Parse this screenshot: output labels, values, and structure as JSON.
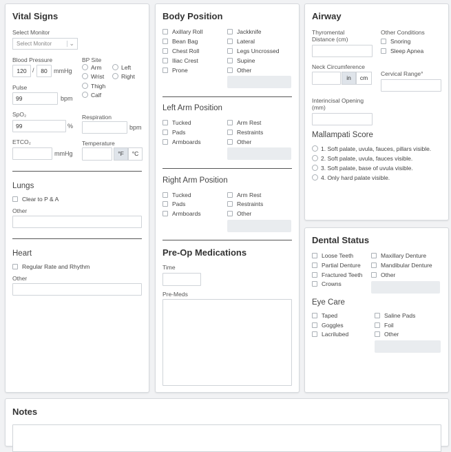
{
  "vital_signs": {
    "title": "Vital Signs",
    "select_monitor_label": "Select Monitor",
    "select_monitor_value": "Select Monitor",
    "bp_label": "Blood Pressure",
    "bp_systolic": "120",
    "bp_slash": "/",
    "bp_diastolic": "80",
    "bp_unit": "mmHg",
    "bp_site_label": "BP Site",
    "bp_sites": [
      "Arm",
      "Wrist",
      "Thigh",
      "Calf",
      "Left",
      "Right"
    ],
    "pulse_label": "Pulse",
    "pulse_value": "99",
    "pulse_unit": "bpm",
    "spo2_label": "SpO₂",
    "spo2_value": "99",
    "spo2_unit": "%",
    "resp_label": "Respiration",
    "resp_unit": "bpm",
    "etco2_label": "ETCO₂",
    "etco2_unit": "mmHg",
    "temp_label": "Temperature",
    "temp_f": "°F",
    "temp_c": "°C"
  },
  "lungs": {
    "title": "Lungs",
    "option": "Clear to P & A",
    "other_label": "Other"
  },
  "heart": {
    "title": "Heart",
    "option": "Regular Rate and Rhythm",
    "other_label": "Other"
  },
  "body_position": {
    "title": "Body Position",
    "col1": [
      "Axillary Roll",
      "Bean Bag",
      "Chest Roll",
      "Iliac Crest",
      "Prone"
    ],
    "col2": [
      "Jackknife",
      "Lateral",
      "Legs Uncrossed",
      "Supine",
      "Other"
    ]
  },
  "left_arm": {
    "title": "Left Arm Position",
    "col1": [
      "Tucked",
      "Pads",
      "Armboards"
    ],
    "col2": [
      "Arm Rest",
      "Restraints",
      "Other"
    ]
  },
  "right_arm": {
    "title": "Right Arm Position",
    "col1": [
      "Tucked",
      "Pads",
      "Armboards"
    ],
    "col2": [
      "Arm Rest",
      "Restraints",
      "Other"
    ]
  },
  "preop": {
    "title": "Pre-Op Medications",
    "time_label": "Time",
    "premeds_label": "Pre-Meds"
  },
  "airway": {
    "title": "Airway",
    "thyro_label_1": "Thyromental",
    "thyro_label_2": "Distance (cm)",
    "other_cond_label": "Other Conditions",
    "other_conditions": [
      "Snoring",
      "Sleep Apnea"
    ],
    "neck_label": "Neck Circumference",
    "unit_in": "in",
    "unit_cm": "cm",
    "cervical_label": "Cervical Range°",
    "interincisal_label_1": "Interincisal Opening",
    "interincisal_label_2": "(mm)",
    "mallampati_title": "Mallampati Score",
    "mallampati": [
      "1. Soft palate, uvula, fauces, pillars visible.",
      "2. Soft palate, uvula, fauces visible.",
      "3. Soft palate, base of uvula visible.",
      "4. Only hard palate visible."
    ]
  },
  "dental": {
    "title": "Dental Status",
    "col1": [
      "Loose Teeth",
      "Partial Denture",
      "Fractured Teeth",
      "Crowns"
    ],
    "col2": [
      "Maxillary Denture",
      "Mandibular Denture",
      "Other"
    ]
  },
  "eye_care": {
    "title": "Eye Care",
    "col1": [
      "Taped",
      "Goggles",
      "Lacrilubed"
    ],
    "col2": [
      "Saline Pads",
      "Foil",
      "Other"
    ]
  },
  "notes": {
    "title": "Notes"
  }
}
